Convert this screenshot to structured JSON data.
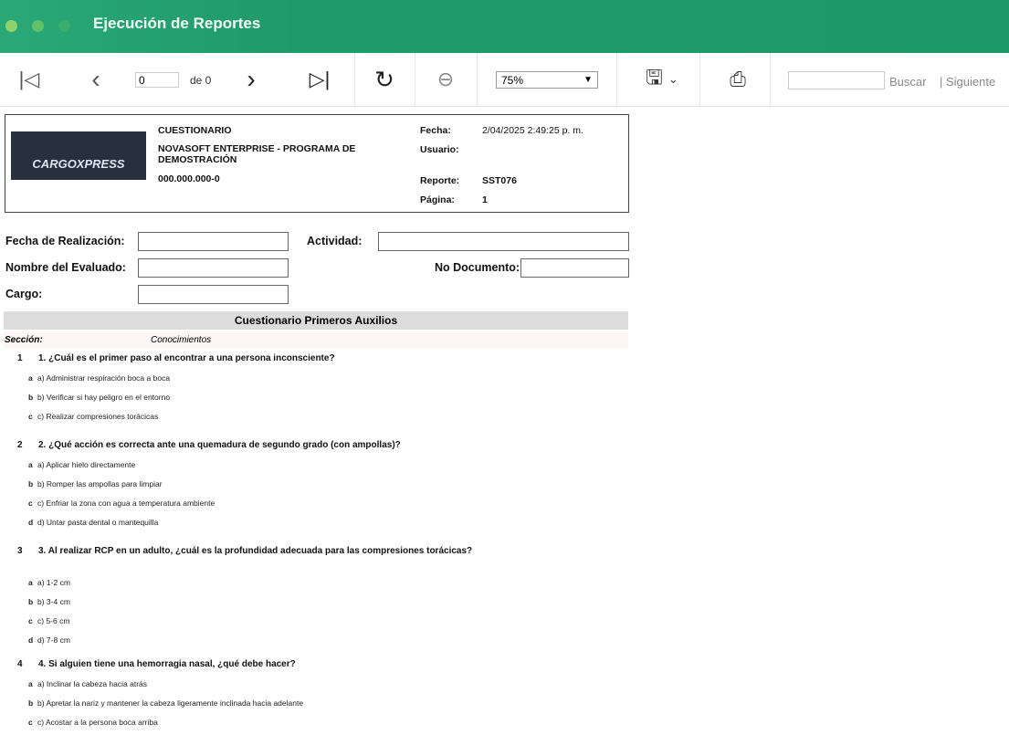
{
  "window": {
    "title": "Ejecución de Reportes"
  },
  "toolbar": {
    "page_value": "0",
    "page_of": "de 0",
    "zoom": "75%",
    "search_label": "Buscar",
    "next_label": "| Siguiente",
    "search_value": ""
  },
  "header": {
    "logo_text": "CARGOXPRESS",
    "title": "CUESTIONARIO",
    "company": "NOVASOFT ENTERPRISE - PROGRAMA DE DEMOSTRACIÓN",
    "nit": "000.000.000-0",
    "fecha_label": "Fecha:",
    "fecha": "2/04/2025 2:49:25 p. m.",
    "usuario_label": "Usuario:",
    "usuario": "",
    "reporte_label": "Reporte:",
    "reporte": "SST076",
    "pagina_label": "Página:",
    "pagina": "1"
  },
  "form": {
    "fecha_realizacion": "Fecha de Realización:",
    "actividad": "Actividad:",
    "nombre": "Nombre del Evaluado:",
    "documento": "No Documento:",
    "cargo": "Cargo:"
  },
  "section_band": "Cuestionario Primeros Auxilios",
  "section": {
    "label": "Sección:",
    "value": "Conocimientos"
  },
  "questions": [
    {
      "num": "1",
      "text": "1. ¿Cuál es el primer paso al encontrar a una persona inconsciente?",
      "options": [
        [
          "a",
          "a) Administrar respiración boca a boca"
        ],
        [
          "b",
          "b) Verificar si hay peligro en el entorno"
        ],
        [
          "c",
          "c) Realizar compresiones torácicas"
        ]
      ]
    },
    {
      "num": "2",
      "text": "2. ¿Qué acción es correcta ante una quemadura de segundo grado (con ampollas)?",
      "options": [
        [
          "a",
          "a) Aplicar hielo directamente"
        ],
        [
          "b",
          "b) Romper las ampollas para limpiar"
        ],
        [
          "c",
          "c) Enfriar la zona con agua a temperatura ambiente"
        ],
        [
          "d",
          "d) Untar pasta dental o mantequilla"
        ]
      ]
    },
    {
      "num": "3",
      "text": "3. Al realizar RCP en un adulto, ¿cuál es la profundidad adecuada para las compresiones torácicas?",
      "options": [
        [
          "a",
          "a) 1-2 cm"
        ],
        [
          "b",
          "b) 3-4 cm"
        ],
        [
          "c",
          "c) 5-6 cm"
        ],
        [
          "d",
          "d) 7-8 cm"
        ]
      ]
    },
    {
      "num": "4",
      "text": "4. Si alguien tiene una hemorragia nasal, ¿qué debe hacer?",
      "options": [
        [
          "a",
          "a) Inclinar la cabeza hacia atrás"
        ],
        [
          "b",
          "b) Apretar la nariz y mantener la cabeza ligeramente inclinada hacia adelante"
        ],
        [
          "c",
          "c) Acostar a la persona boca arriba"
        ]
      ]
    }
  ]
}
